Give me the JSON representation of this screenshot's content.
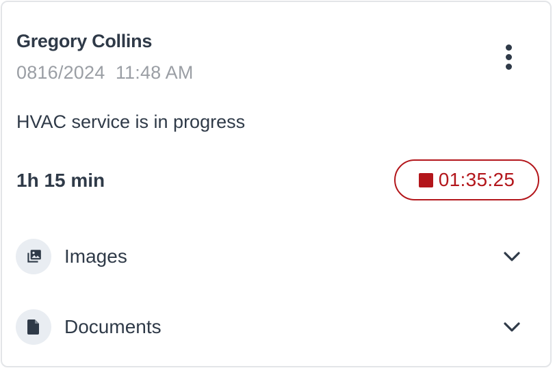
{
  "card": {
    "name": "Gregory Collins",
    "datetime": "0816/2024  11:48 AM",
    "description": "HVAC service is in progress",
    "duration": "1h 15 min",
    "timer": "01:35:25",
    "more_icon": "more-vertical-icon",
    "stop_icon": "stop-icon",
    "accent_color": "#b3161b"
  },
  "sections": [
    {
      "label": "Images",
      "icon": "images-icon",
      "chevron": "chevron-down-icon"
    },
    {
      "label": "Documents",
      "icon": "document-icon",
      "chevron": "chevron-down-icon"
    }
  ]
}
